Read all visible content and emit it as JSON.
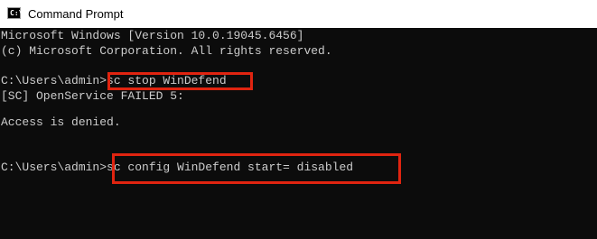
{
  "window": {
    "title": "Command Prompt",
    "icon": "command-prompt-icon",
    "icon_glyph": "C:\\"
  },
  "console": {
    "lines": [
      "Microsoft Windows [Version 10.0.19045.6456]",
      "(c) Microsoft Corporation. All rights reserved.",
      "",
      "C:\\Users\\admin>sc stop WinDefend",
      "[SC] OpenService FAILED 5:",
      "",
      "Access is denied.",
      "",
      "",
      "C:\\Users\\admin>sc config WinDefend start= disabled"
    ],
    "background_color": "#0c0c0c",
    "text_color": "#cccccc"
  },
  "highlights": {
    "color": "#e02410",
    "items": [
      "sc stop WinDefend",
      "sc config WinDefend start= disabled"
    ]
  }
}
